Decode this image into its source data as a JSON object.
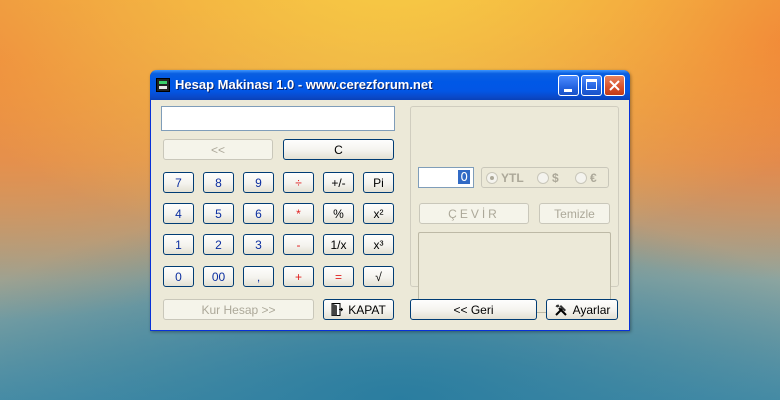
{
  "window": {
    "title": "Hesap Makinası 1.0 - www.cerezforum.net"
  },
  "calculator": {
    "display_value": "",
    "back_label": "<<",
    "clear_label": "C",
    "keys": {
      "k7": "7",
      "k8": "8",
      "k9": "9",
      "div": "÷",
      "sign": "+/-",
      "pi": "Pi",
      "k4": "4",
      "k5": "5",
      "k6": "6",
      "mul": "*",
      "percent": "%",
      "square": "x²",
      "k1": "1",
      "k2": "2",
      "k3": "3",
      "sub": "-",
      "reciprocal": "1/x",
      "cube": "x³",
      "k0": "0",
      "k00": "00",
      "comma": ",",
      "add": "+",
      "equals": "=",
      "root": "√"
    },
    "kur_hesap_label": "Kur Hesap >>",
    "kapat_label": "KAPAT"
  },
  "converter": {
    "amount_value": "0",
    "currencies": [
      "YTL",
      "$",
      "€"
    ],
    "selected_currency": "YTL",
    "convert_label": "ÇEVİR",
    "clear_label": "Temizle",
    "result_text": ""
  },
  "footer": {
    "back_label": "<< Geri",
    "settings_label": "Ayarlar"
  }
}
